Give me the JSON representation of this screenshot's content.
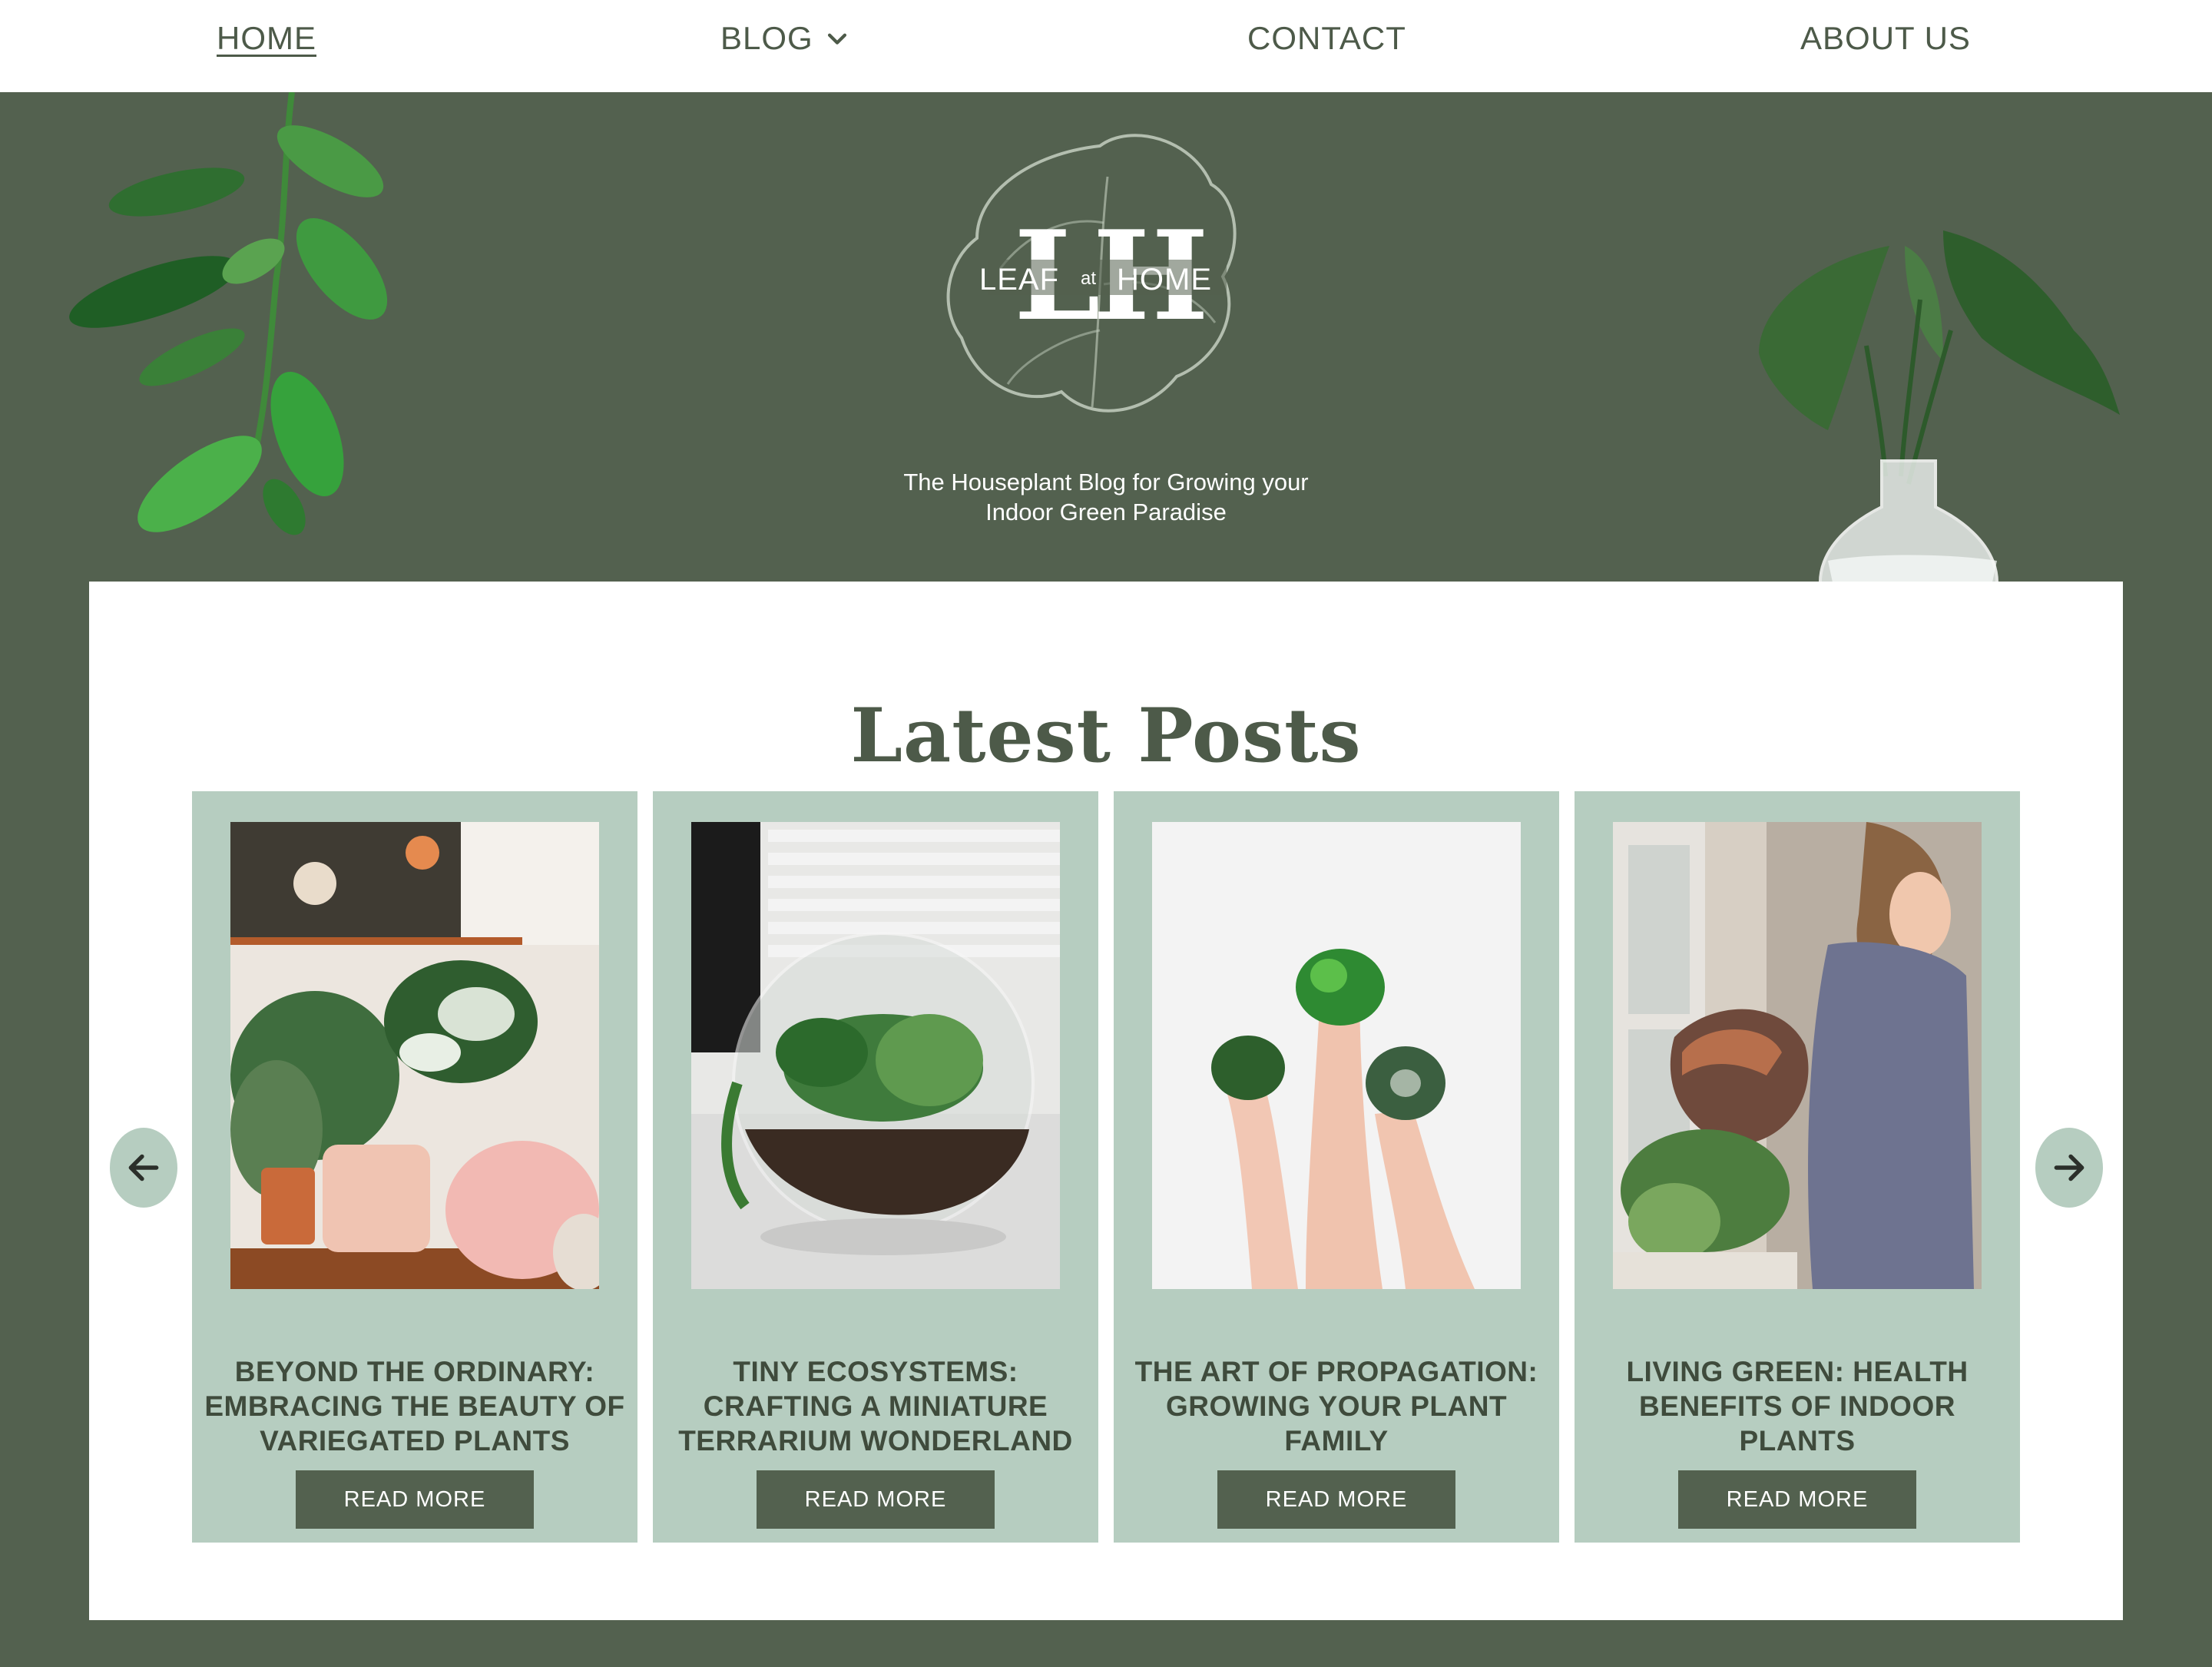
{
  "nav": {
    "home": "HOME",
    "blog": "BLOG",
    "contact": "CONTACT",
    "about": "ABOUT US"
  },
  "hero": {
    "logo": {
      "monogram": "LH",
      "text_left": "LEAF",
      "text_mid": "at",
      "text_right": "HOME"
    },
    "tagline_line1": "The Houseplant Blog for Growing your",
    "tagline_line2": "Indoor Green Paradise"
  },
  "posts": {
    "title": "Latest Posts",
    "read_more_label": "READ MORE",
    "items": [
      {
        "title_lines": [
          "BEYOND THE ORDINARY:",
          "EMBRACING THE BEAUTY OF",
          "VARIEGATED PLANTS"
        ],
        "image": "variegated-plants-photo"
      },
      {
        "title_lines": [
          "TINY ECOSYSTEMS:",
          "CRAFTING A MINIATURE",
          "TERRARIUM WONDERLAND"
        ],
        "image": "terrarium-photo"
      },
      {
        "title_lines": [
          "THE ART OF PROPAGATION:",
          "GROWING YOUR PLANT",
          "FAMILY"
        ],
        "image": "hands-holding-plants-photo"
      },
      {
        "title_lines": [
          "LIVING GREEN: HEALTH",
          "BENEFITS OF INDOOR",
          "PLANTS"
        ],
        "image": "watering-plants-photo"
      }
    ]
  },
  "icons": {
    "prev": "arrow-left-icon",
    "next": "arrow-right-icon",
    "dropdown": "chevron-down-icon"
  },
  "colors": {
    "forest": "#53614f",
    "sage": "#b6cdc0",
    "text": "#4d5a49",
    "white": "#ffffff"
  }
}
